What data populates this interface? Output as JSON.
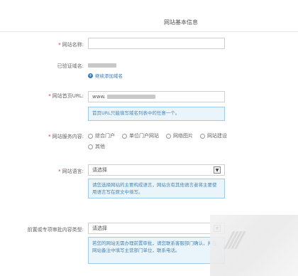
{
  "page": {
    "title": "网站基本信息"
  },
  "form": {
    "site_name": {
      "label": "网站名称:",
      "value": ""
    },
    "verified_domain": {
      "label": "已验证域名:",
      "add_link": "继续添加域名"
    },
    "homepage_url": {
      "label": "网站首页URL:",
      "value_prefix": "www.",
      "hint": "首页URL只能填写域名列表中的任意一个。"
    },
    "service_type": {
      "label": "网站服务内容:",
      "options": [
        "综合门户",
        "单位门户网站",
        "网络图片",
        "网站建设",
        "其他"
      ]
    },
    "language": {
      "label": "网站语言:",
      "selected": "请选择",
      "hint": "请您选择网站的主要构成语言，网站含有其他语言者将主要使用语言写在原文中填写。"
    },
    "preapproval": {
      "label": "前置或专项审批内容类型:",
      "selected": "请选择",
      "hint": "若您的网站无需办理前置审批，请您联系客服部门确认，并在网站备注中填写主营部门单位，联系电话。"
    }
  },
  "colors": {
    "required": "#e22233",
    "hint_bg": "#eaf4fb",
    "hint_border": "#9fcbe6",
    "hint_text": "#4a86b2",
    "link": "#3c79b5"
  }
}
